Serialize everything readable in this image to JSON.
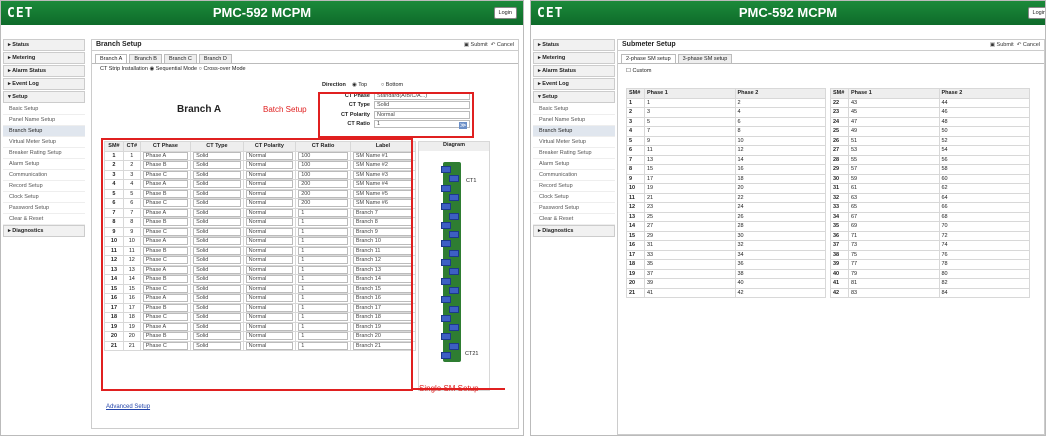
{
  "app": {
    "logo": "CET",
    "title": "PMC-592 MCPM",
    "login": "Login"
  },
  "sidebar": {
    "groups_left": [
      "Status",
      "Metering",
      "Alarm Status",
      "Event Log"
    ],
    "setup": "Setup",
    "items": [
      "Basic Setup",
      "Panel Name Setup",
      "Branch Setup",
      "Virtual Meter Setup",
      "Breaker Rating Setup",
      "Alarm Setup",
      "Communication",
      "Record Setup",
      "Clock Setup",
      "Password Setup",
      "Clear & Reset"
    ],
    "items_right": [
      "Basic Setup",
      "Panel Name Setup",
      "Branch Setup",
      "Virtual Meter Setup",
      "Breaker Rating Setup",
      "Alarm Setup",
      "Communication",
      "Record Setup",
      "Clock Setup",
      "Password Setup",
      "Clear & Reset"
    ],
    "diagnostics": "Diagnostics"
  },
  "left": {
    "title": "Branch Setup",
    "submit": "Submit",
    "cancel": "Cancel",
    "tabs": [
      "Branch A",
      "Branch B",
      "Branch C",
      "Branch D"
    ],
    "strip_label": "CT Strip Installation",
    "mode1": "Sequential Mode",
    "mode2": "Cross-over Mode",
    "branch_heading": "Branch A",
    "direction_label": "Direction",
    "dir_top": "Top",
    "dir_bottom": "Bottom",
    "batch": {
      "ct_phase_label": "CT Phase",
      "ct_phase": "Standard(A/B/C/A...)",
      "ct_type_label": "CT Type",
      "ct_type": "Solid",
      "ct_polarity_label": "CT Polarity",
      "ct_polarity": "Normal",
      "ct_ratio_label": "CT Ratio",
      "ct_ratio": "1"
    },
    "batch_note": "Batch Setup",
    "single_note": "Single SM Setup",
    "headers": [
      "SM#",
      "CT#",
      "CT Phase",
      "CT Type",
      "CT Polarity",
      "CT Ratio",
      "Label",
      "Diagram"
    ],
    "rows": [
      [
        "1",
        "1",
        "Phase A",
        "Solid",
        "Normal",
        "100",
        "SM Name #1"
      ],
      [
        "2",
        "2",
        "Phase B",
        "Solid",
        "Normal",
        "100",
        "SM Name #2"
      ],
      [
        "3",
        "3",
        "Phase C",
        "Solid",
        "Normal",
        "100",
        "SM Name #3"
      ],
      [
        "4",
        "4",
        "Phase A",
        "Solid",
        "Normal",
        "200",
        "SM Name #4"
      ],
      [
        "5",
        "5",
        "Phase B",
        "Solid",
        "Normal",
        "200",
        "SM Name #5"
      ],
      [
        "6",
        "6",
        "Phase C",
        "Solid",
        "Normal",
        "200",
        "SM Name #6"
      ],
      [
        "7",
        "7",
        "Phase A",
        "Solid",
        "Normal",
        "1",
        "Branch 7"
      ],
      [
        "8",
        "8",
        "Phase B",
        "Solid",
        "Normal",
        "1",
        "Branch 8"
      ],
      [
        "9",
        "9",
        "Phase C",
        "Solid",
        "Normal",
        "1",
        "Branch 9"
      ],
      [
        "10",
        "10",
        "Phase A",
        "Solid",
        "Normal",
        "1",
        "Branch 10"
      ],
      [
        "11",
        "11",
        "Phase B",
        "Solid",
        "Normal",
        "1",
        "Branch 11"
      ],
      [
        "12",
        "12",
        "Phase C",
        "Solid",
        "Normal",
        "1",
        "Branch 12"
      ],
      [
        "13",
        "13",
        "Phase A",
        "Solid",
        "Normal",
        "1",
        "Branch 13"
      ],
      [
        "14",
        "14",
        "Phase B",
        "Solid",
        "Normal",
        "1",
        "Branch 14"
      ],
      [
        "15",
        "15",
        "Phase C",
        "Solid",
        "Normal",
        "1",
        "Branch 15"
      ],
      [
        "16",
        "16",
        "Phase A",
        "Solid",
        "Normal",
        "1",
        "Branch 16"
      ],
      [
        "17",
        "17",
        "Phase B",
        "Solid",
        "Normal",
        "1",
        "Branch 17"
      ],
      [
        "18",
        "18",
        "Phase C",
        "Solid",
        "Normal",
        "1",
        "Branch 18"
      ],
      [
        "19",
        "19",
        "Phase A",
        "Solid",
        "Normal",
        "1",
        "Branch 19"
      ],
      [
        "20",
        "20",
        "Phase B",
        "Solid",
        "Normal",
        "1",
        "Branch 20"
      ],
      [
        "21",
        "21",
        "Phase C",
        "Solid",
        "Normal",
        "1",
        "Branch 21"
      ]
    ],
    "ct1": "CT1",
    "ct21": "CT21",
    "advanced": "Advanced Setup"
  },
  "right": {
    "title": "Submeter Setup",
    "submit": "Submit",
    "cancel": "Cancel",
    "tabs": [
      "2-phase SM setup",
      "3-phase SM setup"
    ],
    "custom": "Custom",
    "headers": [
      "SM#",
      "Phase 1",
      "Phase 2"
    ],
    "rows_a": [
      [
        "1",
        "1",
        "2"
      ],
      [
        "2",
        "3",
        "4"
      ],
      [
        "3",
        "5",
        "6"
      ],
      [
        "4",
        "7",
        "8"
      ],
      [
        "5",
        "9",
        "10"
      ],
      [
        "6",
        "11",
        "12"
      ],
      [
        "7",
        "13",
        "14"
      ],
      [
        "8",
        "15",
        "16"
      ],
      [
        "9",
        "17",
        "18"
      ],
      [
        "10",
        "19",
        "20"
      ],
      [
        "11",
        "21",
        "22"
      ],
      [
        "12",
        "23",
        "24"
      ],
      [
        "13",
        "25",
        "26"
      ],
      [
        "14",
        "27",
        "28"
      ],
      [
        "15",
        "29",
        "30"
      ],
      [
        "16",
        "31",
        "32"
      ],
      [
        "17",
        "33",
        "34"
      ],
      [
        "18",
        "35",
        "36"
      ],
      [
        "19",
        "37",
        "38"
      ],
      [
        "20",
        "39",
        "40"
      ],
      [
        "21",
        "41",
        "42"
      ]
    ],
    "rows_b": [
      [
        "22",
        "43",
        "44"
      ],
      [
        "23",
        "45",
        "46"
      ],
      [
        "24",
        "47",
        "48"
      ],
      [
        "25",
        "49",
        "50"
      ],
      [
        "26",
        "51",
        "52"
      ],
      [
        "27",
        "53",
        "54"
      ],
      [
        "28",
        "55",
        "56"
      ],
      [
        "29",
        "57",
        "58"
      ],
      [
        "30",
        "59",
        "60"
      ],
      [
        "31",
        "61",
        "62"
      ],
      [
        "32",
        "63",
        "64"
      ],
      [
        "33",
        "65",
        "66"
      ],
      [
        "34",
        "67",
        "68"
      ],
      [
        "35",
        "69",
        "70"
      ],
      [
        "36",
        "71",
        "72"
      ],
      [
        "37",
        "73",
        "74"
      ],
      [
        "38",
        "75",
        "76"
      ],
      [
        "39",
        "77",
        "78"
      ],
      [
        "40",
        "79",
        "80"
      ],
      [
        "41",
        "81",
        "82"
      ],
      [
        "42",
        "83",
        "84"
      ]
    ]
  }
}
